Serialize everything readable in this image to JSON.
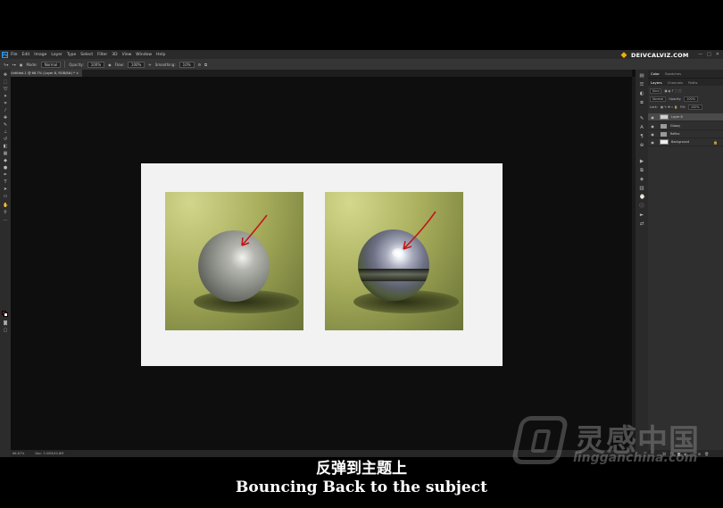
{
  "app": {
    "menu": [
      "File",
      "Edit",
      "Image",
      "Layer",
      "Type",
      "Select",
      "Filter",
      "3D",
      "View",
      "Window",
      "Help"
    ],
    "ps_logo": "Ps",
    "window_controls": [
      "—",
      "□",
      "✕"
    ]
  },
  "brand": {
    "text": "DEIVCALVIZ.COM"
  },
  "options_bar": {
    "mode_label": "Mode:",
    "mode_value": "Normal",
    "opacity_label": "Opacity:",
    "opacity_value": "100%",
    "flow_label": "Flow:",
    "flow_value": "100%",
    "smoothing_label": "Smoothing:",
    "smoothing_value": "10%"
  },
  "document": {
    "tab_title": "Untitled-1 @ 66.7% (Layer 8, RGB/8#) *",
    "tab_close": "×"
  },
  "status_bar": {
    "zoom": "66.67%",
    "doc_info": "Doc: 3.00M/40.8M"
  },
  "panels": {
    "color_tabs": [
      "Color",
      "Swatches"
    ],
    "layers_tabs": [
      "Layers",
      "Channels",
      "Paths"
    ],
    "kind_label": "Kind",
    "blend_mode": "Normal",
    "opacity_label": "Opacity:",
    "opacity_value": "100%",
    "lock_label": "Lock:",
    "fill_label": "Fill:",
    "fill_value": "100%",
    "layers": [
      {
        "name": "Layer 8",
        "type": "layer",
        "selected": true
      },
      {
        "name": "Glossy",
        "type": "group"
      },
      {
        "name": "Reflex",
        "type": "group"
      },
      {
        "name": "Background",
        "type": "background",
        "locked": true
      }
    ],
    "footer_icons": [
      "link",
      "fx",
      "mask",
      "adjust",
      "folder",
      "new",
      "trash"
    ]
  },
  "colors": {
    "annotation_red": "#c01818",
    "accent_blue": "#2e9bf5",
    "foreground_swatch": "#b01010",
    "background_swatch": "#ffffff"
  },
  "watermark": {
    "cn": "灵感中国",
    "en": "lingganchina.com"
  },
  "subtitles": {
    "cn": "反弹到主题上",
    "en": "Bouncing Back to the subject"
  }
}
